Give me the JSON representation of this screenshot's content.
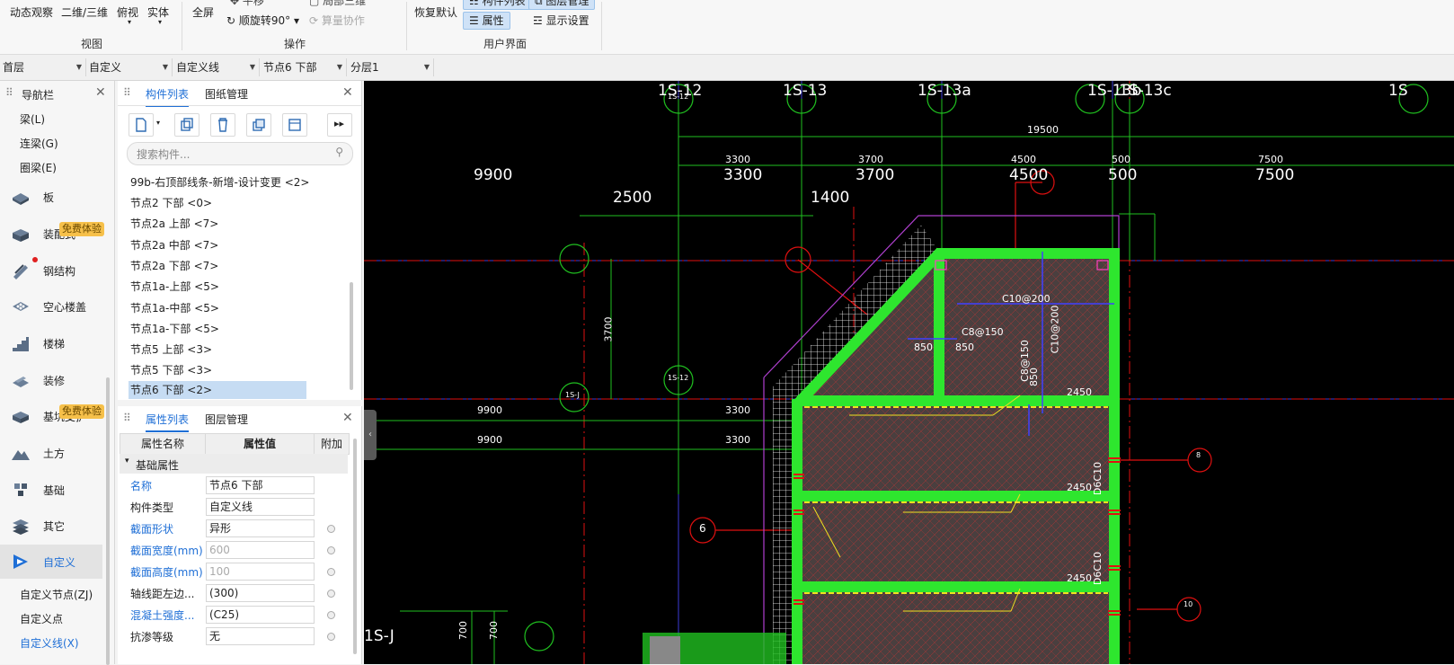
{
  "ribbon": {
    "view_items": [
      "动态观察",
      "二维/三维",
      "俯视",
      "实体"
    ],
    "view_group": "视图",
    "ops_fullscreen": "全屏",
    "ops_move": "平移",
    "ops_rotate": "顺旋转90°",
    "ops_partial": "局部三维",
    "ops_collab": "算量协作",
    "ops_group": "操作",
    "ui_restore": "恢复默认",
    "ui_complist": "构件列表",
    "ui_layer": "图层管理",
    "ui_attr": "属性",
    "ui_display": "显示设置",
    "ui_group": "用户界面"
  },
  "selectors": [
    "首层",
    "自定义",
    "自定义线",
    "节点6 下部",
    "分层1"
  ],
  "nav": {
    "title": "导航栏",
    "subitems_top": [
      "梁(L)",
      "连梁(G)",
      "圈梁(E)"
    ],
    "big_items": [
      {
        "label": "板",
        "icon": "slab-icon"
      },
      {
        "label": "装配式",
        "icon": "prefab-icon",
        "badge": "免费体验"
      },
      {
        "label": "钢结构",
        "icon": "steel-icon"
      },
      {
        "label": "空心楼盖",
        "icon": "hollow-floor-icon"
      },
      {
        "label": "楼梯",
        "icon": "stair-icon"
      },
      {
        "label": "装修",
        "icon": "decoration-icon"
      },
      {
        "label": "基坑支护",
        "icon": "pit-icon",
        "badge": "免费体验"
      },
      {
        "label": "土方",
        "icon": "earthwork-icon"
      },
      {
        "label": "基础",
        "icon": "foundation-icon"
      },
      {
        "label": "其它",
        "icon": "other-icon"
      },
      {
        "label": "自定义",
        "icon": "custom-icon"
      }
    ],
    "subitems_bottom": [
      "自定义节点(ZJ)",
      "自定义点",
      "自定义线(X)"
    ]
  },
  "component_panel": {
    "tab_active": "构件列表",
    "tab_other": "图纸管理",
    "search_placeholder": "搜索构件...",
    "items": [
      "99b-右顶部线条-新增-设计变更 <2>",
      "节点2 下部 <0>",
      "节点2a 上部 <7>",
      "节点2a 中部 <7>",
      "节点2a 下部 <7>",
      "节点1a-上部 <5>",
      "节点1a-中部 <5>",
      "节点1a-下部 <5>",
      "节点5 上部 <3>",
      "节点5 下部 <3>",
      "节点6 下部 <2>"
    ]
  },
  "property_panel": {
    "tab_active": "属性列表",
    "tab_other": "图层管理",
    "col_name": "属性名称",
    "col_value": "属性值",
    "col_extra": "附加",
    "section": "基础属性",
    "rows": [
      {
        "name": "名称",
        "value": "节点6 下部"
      },
      {
        "name": "构件类型",
        "value": "自定义线"
      },
      {
        "name": "截面形状",
        "value": "异形"
      },
      {
        "name": "截面宽度(mm)",
        "value": "600"
      },
      {
        "name": "截面高度(mm)",
        "value": "100"
      },
      {
        "name": "轴线距左边...",
        "value": "(300)"
      },
      {
        "name": "混凝土强度...",
        "value": "(C25)"
      },
      {
        "name": "抗渗等级",
        "value": "无"
      }
    ]
  },
  "cad": {
    "axis_labels": [
      "1S-12",
      "1S-13",
      "1S-13a",
      "1S-13b",
      "1S-13c",
      "1S",
      "1S-J"
    ],
    "dims_large": [
      "9900",
      "3300",
      "3700",
      "4500",
      "500",
      "7500",
      "2500",
      "1400"
    ],
    "dims_small": [
      "19500",
      "3300",
      "3700",
      "4500",
      "500",
      "7500",
      "3700",
      "9900",
      "3300",
      "9900",
      "3300",
      "700",
      "700"
    ],
    "rebar_labels": [
      "C10@200",
      "C10@200",
      "C8@150",
      "C8@150",
      "850",
      "850",
      "850",
      "2450",
      "2450",
      "2450",
      "D6C10",
      "D6C10"
    ],
    "circle_labels": [
      "6",
      "10",
      "8",
      "1S-12",
      "1S-J",
      "1S-12"
    ]
  }
}
